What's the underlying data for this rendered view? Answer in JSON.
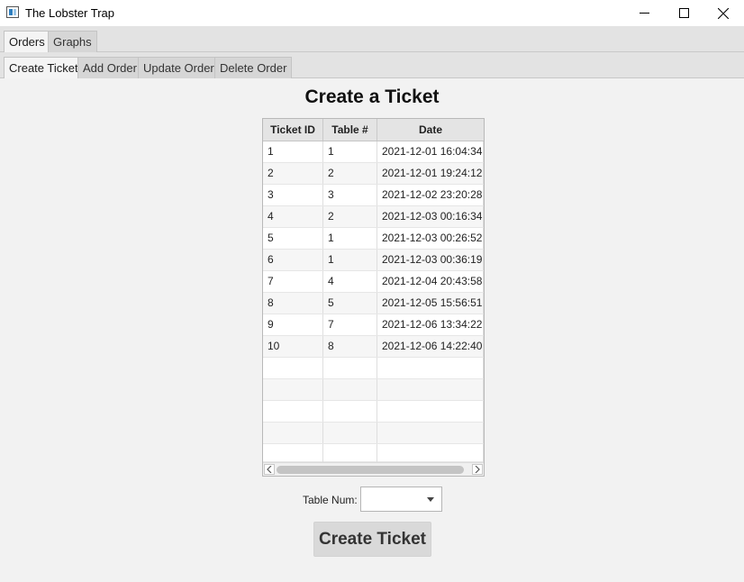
{
  "window": {
    "title": "The Lobster Trap",
    "icon": "app-window-icon",
    "controls": [
      "minimize-icon",
      "maximize-icon",
      "close-icon"
    ]
  },
  "tabs_primary": [
    {
      "label": "Orders",
      "active": true
    },
    {
      "label": "Graphs",
      "active": false
    }
  ],
  "tabs_secondary": [
    {
      "label": "Create Ticket",
      "active": true
    },
    {
      "label": "Add Order",
      "active": false
    },
    {
      "label": "Update Order",
      "active": false
    },
    {
      "label": "Delete Order",
      "active": false
    }
  ],
  "page": {
    "title": "Create a Ticket"
  },
  "table": {
    "columns": [
      "Ticket ID",
      "Table #",
      "Date"
    ],
    "rows": [
      [
        "1",
        "1",
        "2021-12-01 16:04:34"
      ],
      [
        "2",
        "2",
        "2021-12-01 19:24:12"
      ],
      [
        "3",
        "3",
        "2021-12-02 23:20:28"
      ],
      [
        "4",
        "2",
        "2021-12-03 00:16:34"
      ],
      [
        "5",
        "1",
        "2021-12-03 00:26:52"
      ],
      [
        "6",
        "1",
        "2021-12-03 00:36:19"
      ],
      [
        "7",
        "4",
        "2021-12-04 20:43:58"
      ],
      [
        "8",
        "5",
        "2021-12-05 15:56:51"
      ],
      [
        "9",
        "7",
        "2021-12-06 13:34:22"
      ],
      [
        "10",
        "8",
        "2021-12-06 14:22:40"
      ]
    ]
  },
  "form": {
    "table_num_label": "Table Num:",
    "table_num_value": "",
    "create_button": "Create Ticket"
  },
  "colors": {
    "background": "#f2f2f2",
    "tab_bar": "#e3e3e3",
    "button": "#d9d9d9"
  }
}
